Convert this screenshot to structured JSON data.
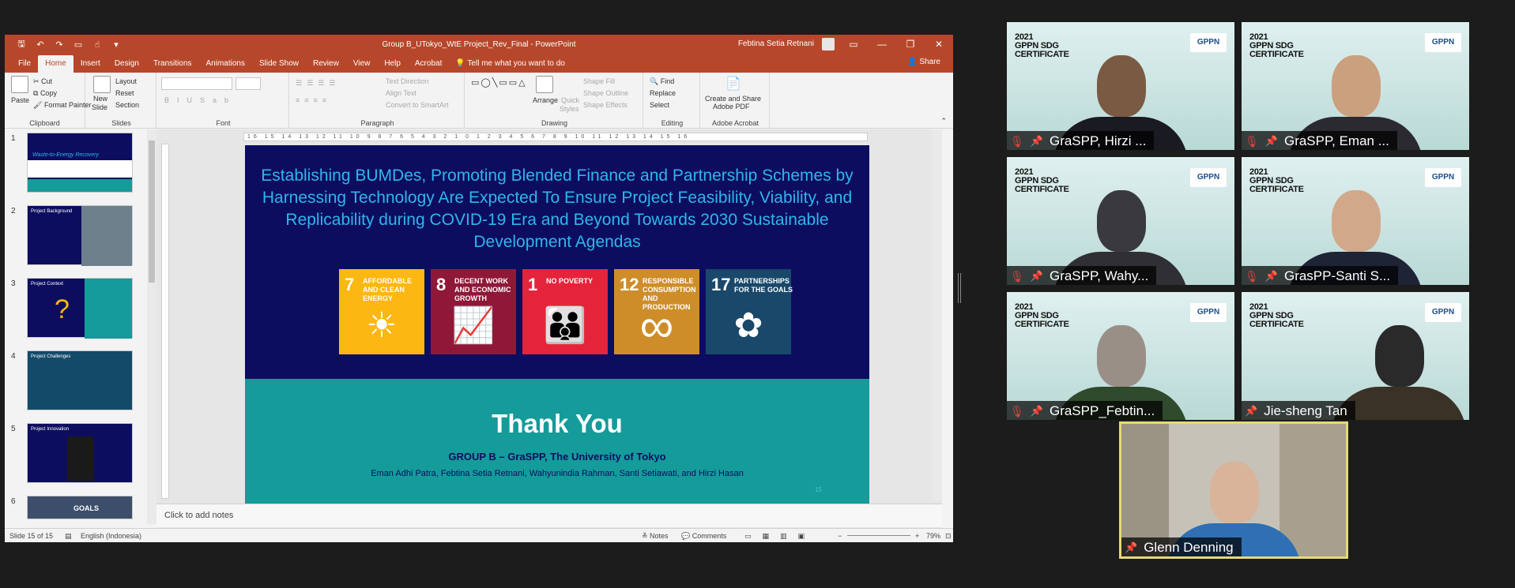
{
  "window": {
    "title": "Group B_UTokyo_WtE Project_Rev_Final  -  PowerPoint",
    "user": "Febtina Setia Retnani"
  },
  "tabs": [
    "File",
    "Home",
    "Insert",
    "Design",
    "Transitions",
    "Animations",
    "Slide Show",
    "Review",
    "View",
    "Help",
    "Acrobat"
  ],
  "tell_me": "Tell me what you want to do",
  "share": "Share",
  "ribbon": {
    "clipboard": {
      "label": "Clipboard",
      "paste": "Paste",
      "cut": "Cut",
      "copy": "Copy",
      "format_painter": "Format Painter"
    },
    "slides": {
      "label": "Slides",
      "new_slide": "New",
      "new_slide2": "Slide",
      "layout": "Layout",
      "reset": "Reset",
      "section": "Section"
    },
    "font": {
      "label": "Font"
    },
    "paragraph": {
      "label": "Paragraph",
      "text_direction": "Text Direction",
      "align_text": "Align Text",
      "convert_smartart": "Convert to SmartArt"
    },
    "drawing": {
      "label": "Drawing",
      "arrange": "Arrange",
      "quick_styles": "Quick",
      "quick_styles2": "Styles",
      "shape_fill": "Shape Fill",
      "shape_outline": "Shape Outline",
      "shape_effects": "Shape Effects"
    },
    "editing": {
      "label": "Editing",
      "find": "Find",
      "replace": "Replace",
      "select": "Select"
    },
    "acrobat": {
      "label": "Adobe Acrobat",
      "create_share": "Create and Share",
      "adobe_pdf": "Adobe PDF"
    }
  },
  "thumbnails": [
    {
      "num": "1",
      "title": "Waste-to-Energy Recovery"
    },
    {
      "num": "2",
      "title": "Project Background"
    },
    {
      "num": "3",
      "title": "Project Context"
    },
    {
      "num": "4",
      "title": "Project Challenges"
    },
    {
      "num": "5",
      "title": "Project Innovation"
    },
    {
      "num": "6",
      "title": "GOALS"
    }
  ],
  "ruler_text": "16 15 14 13 12 11 10 9 8 7 6 5 4 3 2 1 0 1 2 3 4 5 6 7 8 9 10 11 12 13 14 15 16",
  "slide": {
    "title": "Establishing BUMDes, Promoting Blended Finance and Partnership Schemes by  Harnessing Technology Are Expected To Ensure Project Feasibility, Viability, and Replicability during COVID-19 Era and Beyond Towards 2030 Sustainable Development Agendas",
    "sdgs": [
      {
        "num": "7",
        "text": "AFFORDABLE AND CLEAN ENERGY",
        "color": "#fcb712",
        "icon": "sun-power-icon",
        "glyph": "☀"
      },
      {
        "num": "8",
        "text": "DECENT WORK AND ECONOMIC GROWTH",
        "color": "#8f1838",
        "icon": "growth-chart-icon",
        "glyph": "📈"
      },
      {
        "num": "1",
        "text": "NO POVERTY",
        "color": "#e5243b",
        "icon": "family-icon",
        "glyph": "👪"
      },
      {
        "num": "12",
        "text": "RESPONSIBLE CONSUMPTION AND PRODUCTION",
        "color": "#cf8d2a",
        "icon": "infinity-icon",
        "glyph": "∞"
      },
      {
        "num": "17",
        "text": "PARTNERSHIPS FOR THE GOALS",
        "color": "#19486a",
        "icon": "flower-rings-icon",
        "glyph": "✿"
      }
    ],
    "thanks": "Thank You",
    "group": "GROUP B – GraSPP, The University of Tokyo",
    "names": "Eman Adhi Patra, Febtina Setia Retnani, Wahyunindia Rahman, Santi Setiawati, and Hirzi Hasan",
    "page_num": "15"
  },
  "notes_placeholder": "Click to add notes",
  "status": {
    "slide": "Slide 15 of 15",
    "language": "English (Indonesia)",
    "notes": "Notes",
    "comments": "Comments",
    "zoom": "79%"
  },
  "participants": [
    {
      "name": "GraSPP, Hirzi ...",
      "muted": true
    },
    {
      "name": "GraSPP, Eman ...",
      "muted": true
    },
    {
      "name": "GraSPP, Wahy...",
      "muted": true
    },
    {
      "name": "GrasPP-Santi S...",
      "muted": true
    },
    {
      "name": "GraSPP_Febtin...",
      "muted": true
    },
    {
      "name": "Jie-sheng Tan",
      "muted": false
    },
    {
      "name": "Glenn Denning",
      "muted": false
    }
  ],
  "background": {
    "line1": "2021",
    "line2": "GPPN SDG",
    "line3": "CERTIFICATE",
    "logo": "GPPN"
  }
}
